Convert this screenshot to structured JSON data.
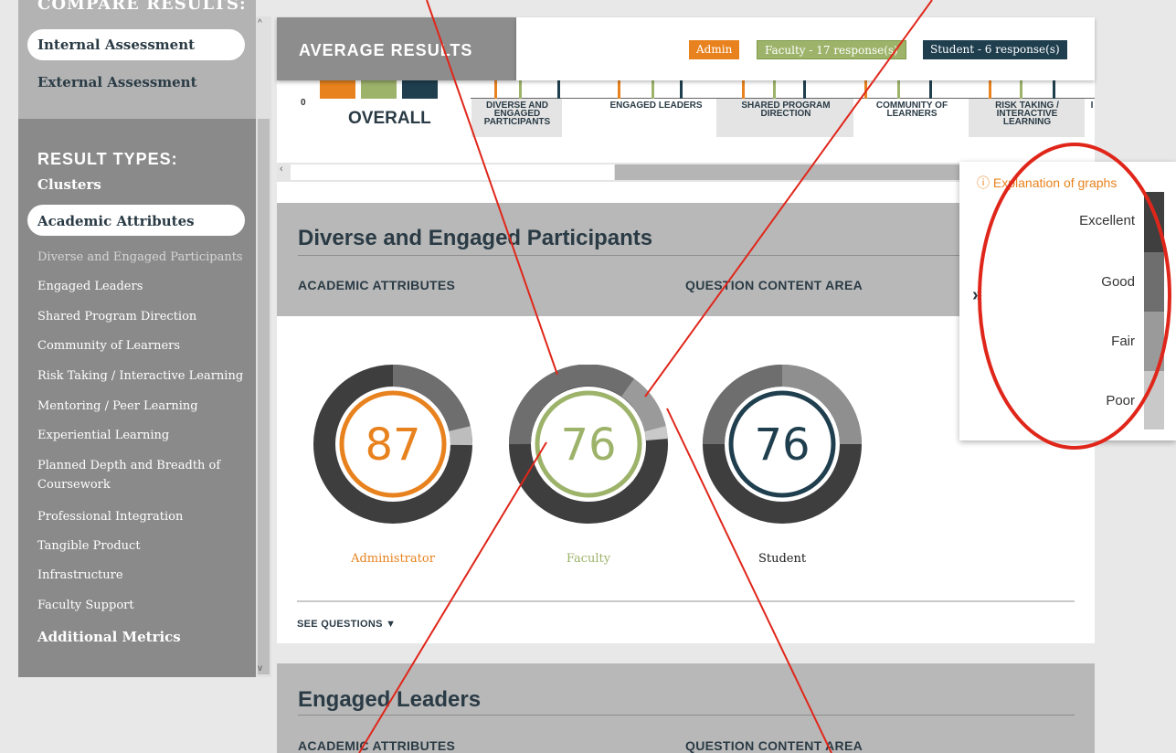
{
  "sidebar": {
    "compare_heading": "COMPARE RESULTS:",
    "internal": "Internal Assessment",
    "external": "External Assessment",
    "result_types_heading": "RESULT TYPES:",
    "clusters": "Clusters",
    "academic": "Academic Attributes",
    "items": [
      "Diverse and Engaged Participants",
      "Engaged Leaders",
      "Shared Program Direction",
      "Community of Learners",
      "Risk Taking / Interactive Learning",
      "Mentoring / Peer Learning",
      "Experiential Learning",
      "Planned Depth and Breadth of Coursework",
      "Professional Integration",
      "Tangible Product",
      "Infrastructure",
      "Faculty Support"
    ],
    "additional": "Additional Metrics"
  },
  "average": {
    "title": "AVERAGE RESULTS",
    "badges": [
      {
        "label": "Admin",
        "color": "#e8821e"
      },
      {
        "label": "Faculty - 17 response(s)",
        "color": "#9db36a"
      },
      {
        "label": "Student - 6 response(s)",
        "color": "#1f3f4f"
      }
    ],
    "zero": "0",
    "overall": "OVERALL",
    "categories": [
      "DIVERSE AND ENGAGED PARTICIPANTS",
      "ENGAGED LEADERS",
      "SHARED PROGRAM DIRECTION",
      "COMMUNITY OF LEARNERS",
      "RISK TAKING / INTERACTIVE LEARNING",
      "I"
    ]
  },
  "section1": {
    "title": "Diverse and Engaged Participants",
    "col1": "ACADEMIC ATTRIBUTES",
    "col2": "QUESTION CONTENT AREA",
    "scores": [
      {
        "role": "Administrator",
        "value": "87",
        "color": "#e8821e"
      },
      {
        "role": "Faculty",
        "value": "76",
        "color": "#9db36a"
      },
      {
        "role": "Student",
        "value": "76",
        "color": "#1f3f4f"
      }
    ],
    "see_questions": "SEE QUESTIONS ▼"
  },
  "section2": {
    "title": "Engaged Leaders",
    "col1": "ACADEMIC ATTRIBUTES",
    "col2": "QUESTION CONTENT AREA"
  },
  "legend": {
    "title": "ⓘ Explanation of graphs",
    "levels": [
      "Excellent",
      "Good",
      "Fair",
      "Poor"
    ],
    "colors": [
      "#3f3f3f",
      "#6e6e6e",
      "#9a9a9a",
      "#c9c9c9"
    ]
  },
  "colors": {
    "admin": "#e8821e",
    "faculty": "#9db36a",
    "student": "#1f3f4f",
    "annotation": "#e0261a"
  }
}
